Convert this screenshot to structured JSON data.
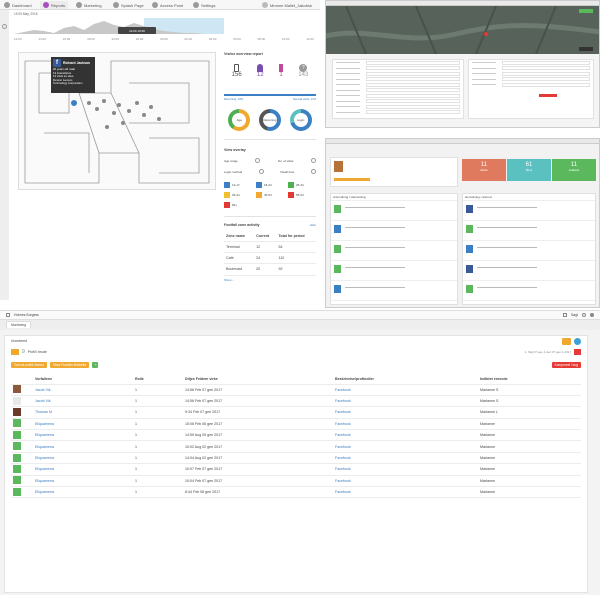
{
  "topleft": {
    "nav": [
      {
        "label": "Dashboard",
        "icon": "dashboard-icon"
      },
      {
        "label": "Reports",
        "icon": "reports-icon"
      },
      {
        "label": "Marketing",
        "icon": "marketing-icon"
      },
      {
        "label": "Splash Page",
        "icon": "splash-icon"
      },
      {
        "label": "Access Point",
        "icon": "access-point-icon"
      },
      {
        "label": "Settings",
        "icon": "settings-icon"
      }
    ],
    "user": "Mmmm Mallet_Jakobsk",
    "timeline": {
      "date": "15 09 May, 2016",
      "hours": [
        "12:00",
        "14:00",
        "16:00",
        "18:00",
        "20:00",
        "22:00",
        "00:00",
        "02:00",
        "04:00",
        "06:00",
        "08:00",
        "10:00",
        "12:00"
      ],
      "window_label": "14:00 10:00"
    },
    "popup": {
      "name": "Richard Jackson",
      "lines": [
        "26 years old male",
        "13 interactions",
        "13 visits so sites",
        "Device: Lenovo",
        "Technology Corporation"
      ]
    },
    "visitor_report": {
      "title": "Visitor overview report",
      "counts": [
        {
          "icon": "phone-icon",
          "value": "156"
        },
        {
          "icon": "female-icon",
          "value": "12"
        },
        {
          "icon": "male-icon",
          "value": "1"
        },
        {
          "icon": "unknown-icon",
          "value": "143"
        }
      ],
      "bar_left": "Returning: 19%",
      "bar_right": "Neutral visits: 13 8",
      "donuts": [
        {
          "label": "Age",
          "color": "#f0a830"
        },
        {
          "label": "Returning",
          "color": "#3b7fc4"
        },
        {
          "label": "Login",
          "color": "#3b7fc4"
        }
      ]
    },
    "overlay": {
      "title": "View overlay",
      "rows": [
        [
          "Age range",
          "No. of visits"
        ],
        [
          "Login method",
          "Dwell time"
        ]
      ],
      "legend": [
        {
          "label": "13-17",
          "color": "#3b7fc4"
        },
        {
          "label": "18-24",
          "color": "#3b7fc4"
        },
        {
          "label": "25-34",
          "color": "#4caf50"
        },
        {
          "label": "35-44",
          "color": "#f0c030"
        },
        {
          "label": "45-54",
          "color": "#f0a830"
        },
        {
          "label": "55-64",
          "color": "#e53935"
        },
        {
          "label": "65+",
          "color": "#e53935"
        }
      ]
    },
    "footfall": {
      "title": "Footfall zone activity",
      "action": "Hide",
      "headers": [
        "Zone name",
        "Current",
        "Total for period"
      ],
      "rows": [
        [
          "Terminal",
          "12",
          "54"
        ],
        [
          "Café",
          "24",
          "110"
        ],
        [
          "Boulevard",
          "20",
          "92"
        ]
      ],
      "footer": "Show ↓"
    }
  },
  "bottom": {
    "topbar": {
      "location": "Holmes Burgess",
      "search": "Søgt"
    },
    "tab": "Monitoring",
    "section": "Unordered",
    "place_count": "9",
    "place_label": "Profil i brude",
    "date_range": "1. Maj 07 gee 1.dec 07 gee 1.2017",
    "chips": [
      {
        "label": "Tomcat politik Marina",
        "color": "#f0a830"
      },
      {
        "label": "Stars Puddles Marbella",
        "color": "#f0a830"
      }
    ],
    "export_label": "Kompromit I bug",
    "headers": [
      "Vorfallene",
      "Rolle",
      "Ditjes Feldem virke",
      "Beskrivelse/profkroller",
      "Indiktet enrecde"
    ],
    "rows": [
      [
        "Jacob Vik",
        "1",
        "14:56 Feb 07 gee 2017",
        "Facebook",
        "Marianne S"
      ],
      [
        "Jacob Vik",
        "1",
        "14:56 Feb 07 gee 2017",
        "Facebook",
        "Marianne S"
      ],
      [
        "Thomas M",
        "1",
        "9:34 Feb 07 gee 2017",
        "Facebook",
        "Marianne L"
      ],
      [
        "Eliquamena",
        "1",
        "15:06 Feb 06 gee 2017",
        "Facebook",
        "Marianne"
      ],
      [
        "Eliquamena",
        "1",
        "14:59 Aug 05 gee 2017",
        "Facebook",
        "Marianne"
      ],
      [
        "Eliquamena",
        "1",
        "10:02 Aug 02 gee 2017",
        "Facebook",
        "Marianne"
      ],
      [
        "Eliquamena",
        "1",
        "14:04 Aug 02 gee 2017",
        "Facebook",
        "Marianne"
      ],
      [
        "Eliquamena",
        "1",
        "10:07 Feb 07 gee 2017",
        "Facebook",
        "Marianne"
      ],
      [
        "Eliquamena",
        "1",
        "10:04 Feb 07 gee 2017",
        "Facebook",
        "Marianne"
      ],
      [
        "Eliquamena",
        "1",
        "8:44 Feb 08 gee 2017",
        "Facebook",
        "Marianne"
      ]
    ]
  },
  "tr2": {
    "stats": [
      {
        "value": "11",
        "label": "Aktive",
        "color": "#e07a5f"
      },
      {
        "value": "61",
        "label": "Åbne",
        "color": "#5bc0c0"
      },
      {
        "value": "11",
        "label": "Lukkede",
        "color": "#5cb85c"
      }
    ],
    "left_title": "Anmodning / Henvisning",
    "right_title": "Henvisning / anmod"
  }
}
